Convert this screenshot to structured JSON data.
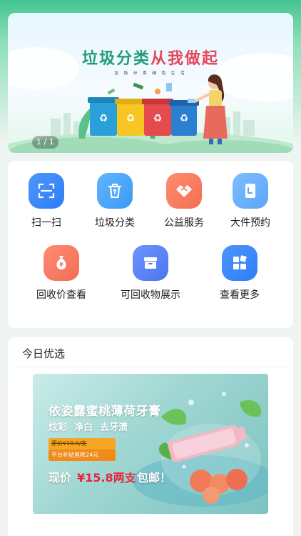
{
  "banner": {
    "title_main": "垃圾分类",
    "title_accent": "从我做起",
    "subtitle": "垃 圾 分 类 绿 色 生 活",
    "counter": "1 / 1"
  },
  "services": [
    {
      "label": "扫一扫",
      "icon": "scan-icon",
      "color": "#2f7cf6"
    },
    {
      "label": "垃圾分类",
      "icon": "trash-icon",
      "color": "#3a9bf5"
    },
    {
      "label": "公益服务",
      "icon": "handshake-icon",
      "color": "#f36f53"
    },
    {
      "label": "大件预约",
      "icon": "document-icon",
      "color": "#5aa6f7"
    },
    {
      "label": "回收价查看",
      "icon": "money-bag-icon",
      "color": "#f26d57"
    },
    {
      "label": "可回收物展示",
      "icon": "box-icon",
      "color": "#4b76f0"
    },
    {
      "label": "查看更多",
      "icon": "grid-more-icon",
      "color": "#2f7cf6"
    }
  ],
  "daily_pick": {
    "heading": "今日优选",
    "ad": {
      "title": "依姿露蜜桃薄荷牙膏",
      "tags": [
        "炫彩",
        "净白",
        "去牙渍"
      ],
      "original_price": "原价¥19.9/支",
      "subsidy": "平台补贴直降24元",
      "now_label": "现价",
      "now_price": "¥15.8两支",
      "now_tail": "包邮！"
    }
  }
}
